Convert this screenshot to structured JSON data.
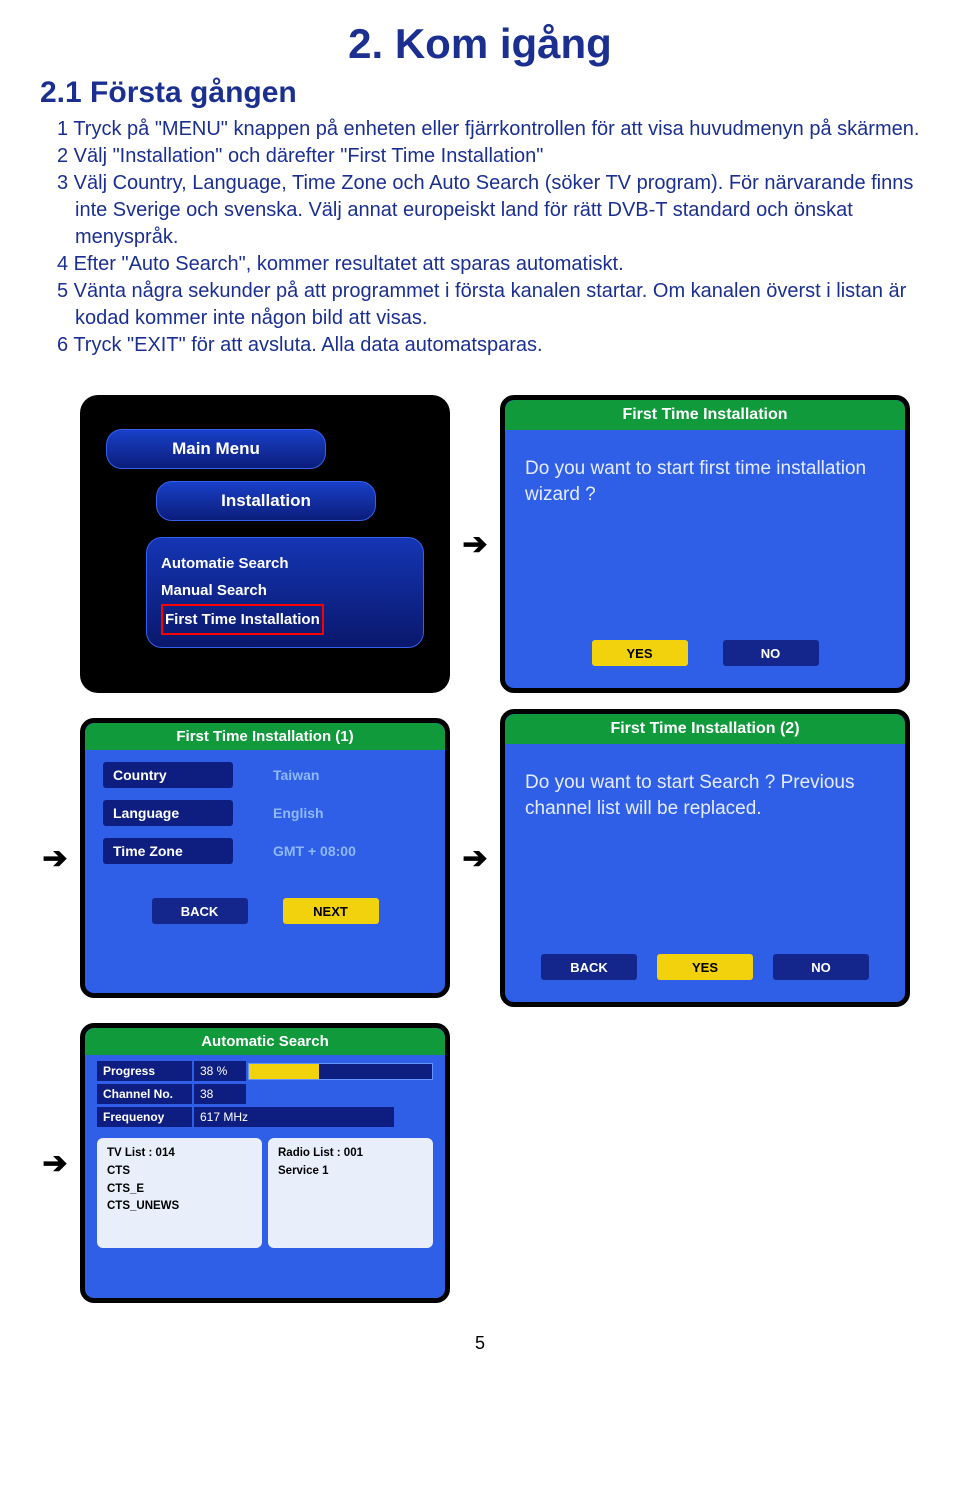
{
  "title": "2. Kom igång",
  "subtitle": "2.1   Första gången",
  "instructions": [
    "1 Tryck på \"MENU\" knappen på enheten eller fjärrkontrollen för att visa huvudmenyn på skärmen.",
    "2 Välj \"Installation\" och därefter \"First Time Installation\"",
    "3 Välj Country, Language, Time Zone och Auto Search (söker TV program). För närvarande finns inte Sverige och svenska. Välj annat europeiskt land för rätt DVB-T standard och önskat menyspråk.",
    "4 Efter \"Auto Search\", kommer resultatet att sparas automatiskt.",
    "5 Vänta några sekunder på att programmet i första kanalen startar. Om kanalen överst i listan är kodad kommer inte någon bild att visas.",
    "6 Tryck \"EXIT\" för att avsluta. Alla data automatsparas."
  ],
  "screen1": {
    "main": "Main Menu",
    "sub": "Installation",
    "items": [
      "Automatie Search",
      "Manual Search",
      "First Time Installation"
    ]
  },
  "screen2": {
    "header": "First Time Installation",
    "msg": "Do you want to start first time installation wizard ?",
    "yes": "YES",
    "no": "NO"
  },
  "screen3": {
    "header": "First Time Installation (1)",
    "rows": [
      {
        "label": "Country",
        "val": "Taiwan"
      },
      {
        "label": "Language",
        "val": "English"
      },
      {
        "label": "Time Zone",
        "val": "GMT + 08:00"
      }
    ],
    "back": "BACK",
    "next": "NEXT"
  },
  "screen4": {
    "header": "First Time Installation (2)",
    "msg": "Do you want to start Search ? Previous channel list will be replaced.",
    "back": "BACK",
    "yes": "YES",
    "no": "NO"
  },
  "screen5": {
    "header": "Automatic Search",
    "progress_label": "Progress",
    "progress_val": "38 %",
    "channel_label": "Channel No.",
    "channel_val": "38",
    "freq_label": "Frequenoy",
    "freq_val": "617 MHz",
    "tv_header": "TV List :   014",
    "tv_items": [
      "CTS",
      "CTS_E",
      "CTS_UNEWS"
    ],
    "radio_header": "Radio List :   001",
    "radio_items": [
      "Service 1"
    ]
  },
  "page": "5"
}
